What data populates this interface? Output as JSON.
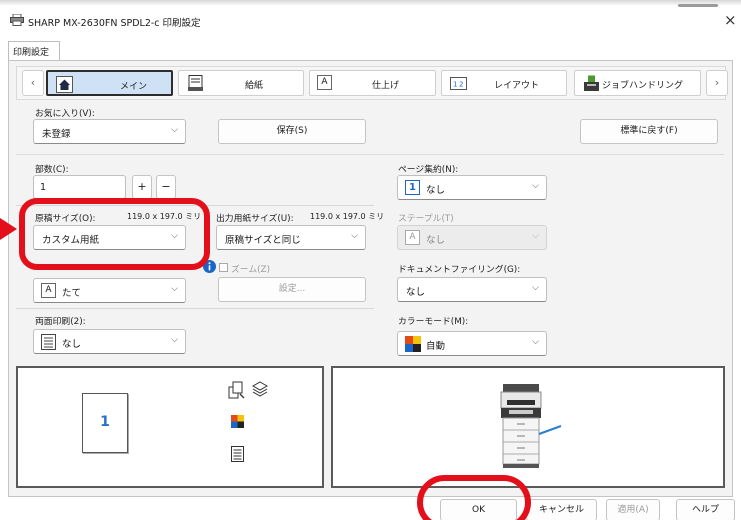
{
  "window": {
    "title": "SHARP MX-2630FN SPDL2-c 印刷設定",
    "close_label": "×"
  },
  "page_tab": "印刷設定",
  "categories": [
    {
      "label": "メイン",
      "icon": "house-icon",
      "selected": true
    },
    {
      "label": "給紙",
      "icon": "paper-tray-icon",
      "selected": false
    },
    {
      "label": "仕上げ",
      "icon": "finishing-icon",
      "selected": false
    },
    {
      "label": "レイアウト",
      "icon": "layout-icon",
      "selected": false
    },
    {
      "label": "ジョブハンドリング",
      "icon": "job-handling-icon",
      "selected": false
    }
  ],
  "nav": {
    "prev": "‹",
    "next": "›"
  },
  "favorites": {
    "label": "お気に入り(V):",
    "value": "未登録",
    "save_button": "保存(S)",
    "reset_button": "標準に戻す(F)"
  },
  "copies": {
    "label": "部数(C):",
    "value": "1",
    "plus": "+",
    "minus": "−"
  },
  "original_size": {
    "label": "原稿サイズ(O):",
    "dims": "119.0 x 197.0 ミリ",
    "value": "カスタム用紙"
  },
  "output_size": {
    "label": "出力用紙サイズ(U):",
    "dims": "119.0 x 197.0 ミリ",
    "value": "原稿サイズと同じ"
  },
  "orientation": {
    "value": "たて",
    "icon_char": "A"
  },
  "zoom": {
    "label": "ズーム(Z)",
    "settings_button": "設定..."
  },
  "duplex": {
    "label": "両面印刷(2):",
    "value": "なし"
  },
  "n_up": {
    "label": "ページ集約(N):",
    "value": "なし",
    "icon_char": "1"
  },
  "staple": {
    "label": "ステープル(T)",
    "value": "なし",
    "icon_char": "A"
  },
  "doc_filing": {
    "label": "ドキュメントファイリング(G):",
    "value": "なし"
  },
  "color_mode": {
    "label": "カラーモード(M):",
    "value": "自動"
  },
  "preview": {
    "page_number": "1"
  },
  "buttons": {
    "ok": "OK",
    "cancel": "キャンセル",
    "apply": "適用(A)",
    "help": "ヘルプ"
  },
  "colors": {
    "annotation": "#e3101b",
    "selected_tab": "#cfe1f4",
    "accent": "#2a6fd0"
  }
}
